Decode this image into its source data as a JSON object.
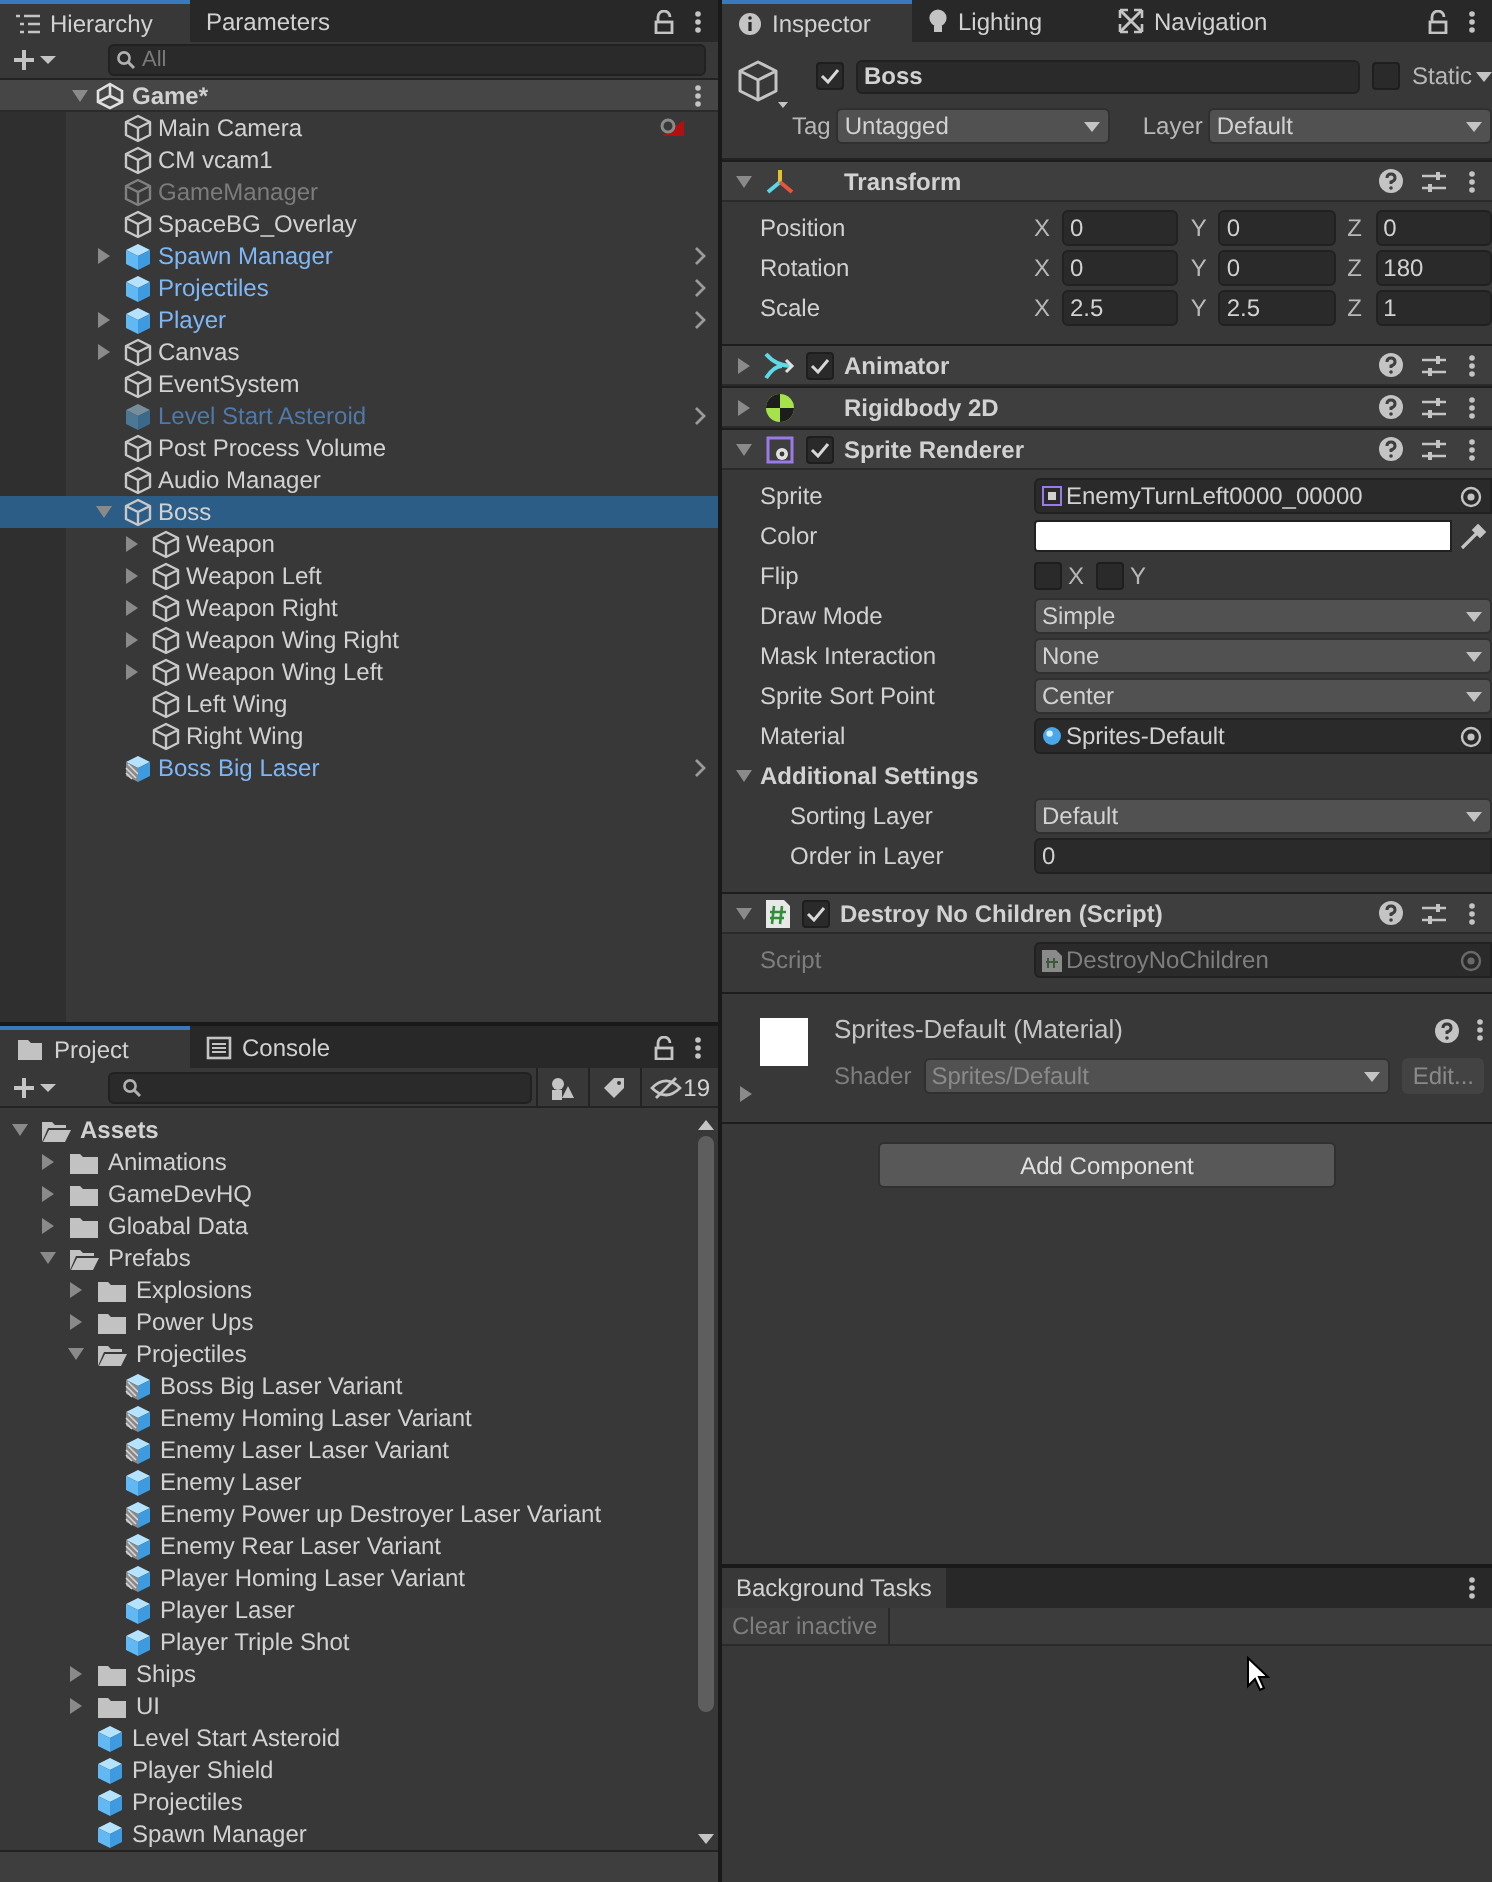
{
  "hierarchy": {
    "tabs": [
      {
        "label": "Hierarchy",
        "selected": true
      },
      {
        "label": "Parameters",
        "selected": false
      }
    ],
    "search": {
      "placeholder": "All"
    },
    "scene": {
      "label": "Game*",
      "expanded": true
    },
    "items": [
      {
        "label": "Main Camera",
        "kind": "object",
        "active": true,
        "selected": false,
        "alert": true
      },
      {
        "label": "CM vcam1",
        "kind": "object",
        "active": true,
        "selected": false
      },
      {
        "label": "GameManager",
        "kind": "object",
        "active": false,
        "selected": false
      },
      {
        "label": "SpaceBG_Overlay",
        "kind": "object",
        "active": true,
        "selected": false
      },
      {
        "label": "Spawn Manager",
        "kind": "prefab",
        "active": true,
        "selected": false,
        "expanded": false
      },
      {
        "label": "Projectiles",
        "kind": "prefab",
        "active": true,
        "selected": false
      },
      {
        "label": "Player",
        "kind": "prefab",
        "active": true,
        "selected": false,
        "expanded": false
      },
      {
        "label": "Canvas",
        "kind": "object",
        "active": true,
        "selected": false,
        "expanded": false
      },
      {
        "label": "EventSystem",
        "kind": "object",
        "active": true,
        "selected": false
      },
      {
        "label": "Level Start Asteroid",
        "kind": "prefab",
        "active": false,
        "selected": false
      },
      {
        "label": "Post Process Volume",
        "kind": "object",
        "active": true,
        "selected": false
      },
      {
        "label": "Audio Manager",
        "kind": "object",
        "active": true,
        "selected": false
      },
      {
        "label": "Boss",
        "kind": "object",
        "active": true,
        "selected": true,
        "expanded": true,
        "children": [
          {
            "label": "Weapon",
            "kind": "object",
            "active": true,
            "selected": false,
            "expanded": false
          },
          {
            "label": "Weapon Left",
            "kind": "object",
            "active": true,
            "selected": false,
            "expanded": false
          },
          {
            "label": "Weapon Right",
            "kind": "object",
            "active": true,
            "selected": false,
            "expanded": false
          },
          {
            "label": "Weapon Wing Right",
            "kind": "object",
            "active": true,
            "selected": false,
            "expanded": false
          },
          {
            "label": "Weapon Wing Left",
            "kind": "object",
            "active": true,
            "selected": false,
            "expanded": false
          },
          {
            "label": "Left Wing",
            "kind": "object",
            "active": true,
            "selected": false
          },
          {
            "label": "Right Wing",
            "kind": "object",
            "active": true,
            "selected": false
          }
        ]
      },
      {
        "label": "Boss Big Laser",
        "kind": "variant",
        "active": true,
        "selected": false
      }
    ]
  },
  "project": {
    "tabs": [
      {
        "label": "Project",
        "selected": true
      },
      {
        "label": "Console",
        "selected": false
      }
    ],
    "hidden_count": "19",
    "items": [
      {
        "label": "Assets",
        "kind": "folder",
        "expanded": true,
        "children": [
          {
            "label": "Animations",
            "kind": "folder",
            "expanded": false
          },
          {
            "label": "GameDevHQ",
            "kind": "folder",
            "expanded": false
          },
          {
            "label": "Gloabal Data",
            "kind": "folder",
            "expanded": false
          },
          {
            "label": "Prefabs",
            "kind": "folder",
            "expanded": true,
            "children": [
              {
                "label": "Explosions",
                "kind": "folder",
                "expanded": false
              },
              {
                "label": "Power Ups",
                "kind": "folder",
                "expanded": false
              },
              {
                "label": "Projectiles",
                "kind": "folder",
                "expanded": true,
                "children": [
                  {
                    "label": "Boss Big Laser Variant",
                    "kind": "variant"
                  },
                  {
                    "label": "Enemy Homing Laser Variant",
                    "kind": "variant"
                  },
                  {
                    "label": "Enemy Laser Laser Variant",
                    "kind": "variant"
                  },
                  {
                    "label": "Enemy Laser",
                    "kind": "prefab"
                  },
                  {
                    "label": "Enemy Power up Destroyer Laser Variant",
                    "kind": "variant"
                  },
                  {
                    "label": "Enemy Rear Laser Variant",
                    "kind": "variant"
                  },
                  {
                    "label": "Player Homing Laser Variant",
                    "kind": "variant"
                  },
                  {
                    "label": "Player Laser",
                    "kind": "prefab"
                  },
                  {
                    "label": "Player Triple Shot",
                    "kind": "prefab"
                  }
                ]
              },
              {
                "label": "Ships",
                "kind": "folder",
                "expanded": false
              },
              {
                "label": "UI",
                "kind": "folder",
                "expanded": false
              },
              {
                "label": "Level Start Asteroid",
                "kind": "prefab"
              },
              {
                "label": "Player Shield",
                "kind": "prefab"
              },
              {
                "label": "Projectiles",
                "kind": "prefab"
              },
              {
                "label": "Spawn Manager",
                "kind": "prefab"
              }
            ]
          }
        ]
      }
    ]
  },
  "inspector": {
    "tabs": [
      {
        "label": "Inspector",
        "selected": true
      },
      {
        "label": "Lighting",
        "selected": false
      },
      {
        "label": "Navigation",
        "selected": false
      }
    ],
    "object": {
      "active": true,
      "name": "Boss",
      "static": false,
      "static_label": "Static",
      "tag_label": "Tag",
      "tag": "Untagged",
      "layer_label": "Layer",
      "layer": "Default"
    },
    "components": [
      {
        "kind": "transform",
        "title": "Transform",
        "expanded": true,
        "rows": [
          {
            "label": "Position",
            "values": [
              {
                "axis": "X",
                "value": "0"
              },
              {
                "axis": "Y",
                "value": "0"
              },
              {
                "axis": "Z",
                "value": "0"
              }
            ]
          },
          {
            "label": "Rotation",
            "values": [
              {
                "axis": "X",
                "value": "0"
              },
              {
                "axis": "Y",
                "value": "0"
              },
              {
                "axis": "Z",
                "value": "180"
              }
            ]
          },
          {
            "label": "Scale",
            "values": [
              {
                "axis": "X",
                "value": "2.5"
              },
              {
                "axis": "Y",
                "value": "2.5"
              },
              {
                "axis": "Z",
                "value": "1"
              }
            ]
          }
        ]
      },
      {
        "kind": "animator",
        "title": "Animator",
        "expanded": false,
        "enabled": true
      },
      {
        "kind": "rigidbody",
        "title": "Rigidbody 2D",
        "expanded": false
      },
      {
        "kind": "sprite_renderer",
        "title": "Sprite Renderer",
        "expanded": true,
        "enabled": true,
        "fields": [
          {
            "kind": "sprite",
            "label": "Sprite",
            "value": "EnemyTurnLeft0000_00000"
          },
          {
            "kind": "color",
            "label": "Color",
            "color": "#ffffff"
          },
          {
            "kind": "flip",
            "label": "Flip",
            "options": [
              {
                "label": "X",
                "checked": false
              },
              {
                "label": "Y",
                "checked": false
              }
            ]
          },
          {
            "kind": "dropdown",
            "label": "Draw Mode",
            "value": "Simple"
          },
          {
            "kind": "dropdown",
            "label": "Mask Interaction",
            "value": "None"
          },
          {
            "kind": "dropdown",
            "label": "Sprite Sort Point",
            "value": "Center"
          },
          {
            "kind": "material",
            "label": "Material",
            "value": "Sprites-Default"
          },
          {
            "kind": "foldout",
            "label": "Additional Settings",
            "expanded": true,
            "children": [
              {
                "kind": "dropdown",
                "label": "Sorting Layer",
                "value": "Default"
              },
              {
                "kind": "number",
                "label": "Order in Layer",
                "value": "0"
              }
            ]
          }
        ]
      },
      {
        "kind": "script",
        "title": "Destroy No Children (Script)",
        "expanded": true,
        "enabled": true,
        "fields": [
          {
            "kind": "script",
            "label": "Script",
            "value": "DestroyNoChildren",
            "disabled": true
          }
        ]
      }
    ],
    "material": {
      "title": "Sprites-Default (Material)",
      "shader_label": "Shader",
      "shader": "Sprites/Default",
      "edit": "Edit...",
      "expanded": false
    },
    "add_component": "Add Component"
  },
  "background_tasks": {
    "tab": "Background Tasks",
    "button": "Clear inactive"
  }
}
